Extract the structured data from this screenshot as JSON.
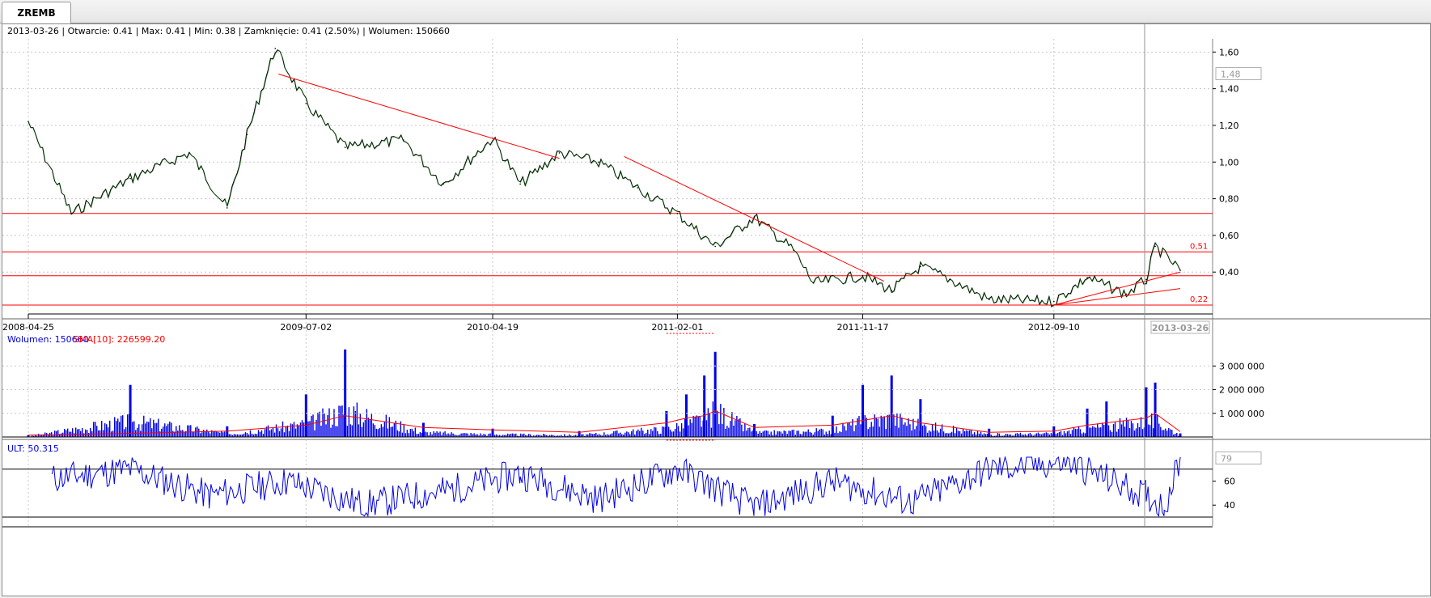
{
  "tab": {
    "label": "ZREMB"
  },
  "info_line": "2013-03-26 | Otwarcie: 0.41 | Max: 0.41 | Min: 0.38 | Zamknięcie: 0.41 (2.50%) | Wolumen: 150660",
  "volume_legend": {
    "volume": "Wolumen: 150660",
    "sma": "SMA[10]: 226599.20"
  },
  "ult_legend": "ULT: 50.315",
  "colors": {
    "price": "#000000",
    "price_up": "#007a00",
    "trend": "#ff0000",
    "volume": "#0000e6",
    "sma": "#ff0000",
    "ult": "#0000e6",
    "grid": "#c8c8c8"
  },
  "chart_data": [
    {
      "type": "line",
      "name": "price",
      "x": [
        "2008-04-25",
        "2008-07-01",
        "2008-10-01",
        "2009-01-01",
        "2009-03-01",
        "2009-04-01",
        "2009-05-15",
        "2009-07-02",
        "2009-09-01",
        "2009-12-01",
        "2010-02-01",
        "2010-04-19",
        "2010-06-01",
        "2010-08-01",
        "2010-10-01",
        "2010-12-01",
        "2011-02-01",
        "2011-04-01",
        "2011-06-01",
        "2011-08-01",
        "2011-09-01",
        "2011-11-17",
        "2012-01-01",
        "2012-02-15",
        "2012-04-01",
        "2012-06-01",
        "2012-09-10",
        "2012-11-01",
        "2013-01-01",
        "2013-02-01",
        "2013-02-15",
        "2013-03-26"
      ],
      "y": [
        1.22,
        0.72,
        0.91,
        1.05,
        0.75,
        1.15,
        1.62,
        1.32,
        1.08,
        1.12,
        0.88,
        1.13,
        0.88,
        1.05,
        1.0,
        0.86,
        0.72,
        0.54,
        0.7,
        0.52,
        0.34,
        0.38,
        0.3,
        0.43,
        0.36,
        0.25,
        0.24,
        0.37,
        0.28,
        0.36,
        0.54,
        0.41
      ],
      "y_ticks": [
        "1,60",
        "1,40",
        "1,20",
        "1,00",
        "0,80",
        "0,60",
        "0,40"
      ],
      "x_ticks": [
        "2008-04-25",
        "2009-07-02",
        "2010-04-19",
        "2011-02-01",
        "2011-11-17",
        "2012-09-10"
      ],
      "current_date_label": "2013-03-26",
      "marker_label": "1,48",
      "levels": [
        {
          "value": 0.72
        },
        {
          "value": 0.51,
          "label": "0,51"
        },
        {
          "value": 0.38
        },
        {
          "value": 0.22,
          "label": "0,22"
        }
      ],
      "trendlines": [
        {
          "from": [
            "2009-05-20",
            1.48
          ],
          "to": [
            "2010-08-01",
            1.02
          ]
        },
        {
          "from": [
            "2010-11-10",
            1.03
          ],
          "to": [
            "2011-12-20",
            0.35
          ]
        },
        {
          "from": [
            "2012-09-10",
            0.22
          ],
          "to": [
            "2013-03-26",
            0.4
          ]
        },
        {
          "from": [
            "2012-09-10",
            0.22
          ],
          "to": [
            "2013-03-26",
            0.31
          ]
        }
      ]
    },
    {
      "type": "bar",
      "name": "volume",
      "x": [
        "2008-04-25",
        "2008-10-01",
        "2009-03-01",
        "2009-07-02",
        "2009-09-01",
        "2010-01-01",
        "2010-04-19",
        "2010-09-01",
        "2011-01-15",
        "2011-02-15",
        "2011-03-15",
        "2011-04-01",
        "2011-06-01",
        "2011-10-01",
        "2011-11-17",
        "2012-01-01",
        "2012-02-15",
        "2012-06-01",
        "2012-09-10",
        "2012-11-01",
        "2012-12-01",
        "2013-02-01",
        "2013-02-15",
        "2013-03-26"
      ],
      "values": [
        80000,
        2200000,
        450000,
        1800000,
        3700000,
        600000,
        350000,
        250000,
        1100000,
        1800000,
        2600000,
        3600000,
        550000,
        900000,
        2200000,
        2600000,
        1600000,
        350000,
        450000,
        1200000,
        1500000,
        2100000,
        2300000,
        150660
      ],
      "sma": [
        80000,
        150000,
        250000,
        500000,
        900000,
        400000,
        300000,
        200000,
        600000,
        800000,
        900000,
        1100000,
        400000,
        500000,
        700000,
        900000,
        600000,
        200000,
        250000,
        500000,
        600000,
        800000,
        1000000,
        226599
      ],
      "y_ticks": [
        "3 000 000",
        "2 000 000",
        "1 000 000"
      ]
    },
    {
      "type": "line",
      "name": "ULT",
      "x": [
        "2008-06-01",
        "2008-10-01",
        "2009-02-01",
        "2009-06-01",
        "2009-10-01",
        "2010-02-01",
        "2010-06-01",
        "2010-10-01",
        "2011-02-01",
        "2011-06-01",
        "2011-10-01",
        "2012-02-01",
        "2012-06-01",
        "2012-10-01",
        "2013-02-01",
        "2013-03-01",
        "2013-03-26"
      ],
      "values": [
        62,
        70,
        48,
        60,
        40,
        52,
        66,
        45,
        70,
        38,
        60,
        42,
        70,
        76,
        48,
        38,
        79
      ],
      "y_ticks": [
        "60",
        "40"
      ],
      "current_label": "79",
      "levels": [
        70,
        30
      ]
    }
  ]
}
